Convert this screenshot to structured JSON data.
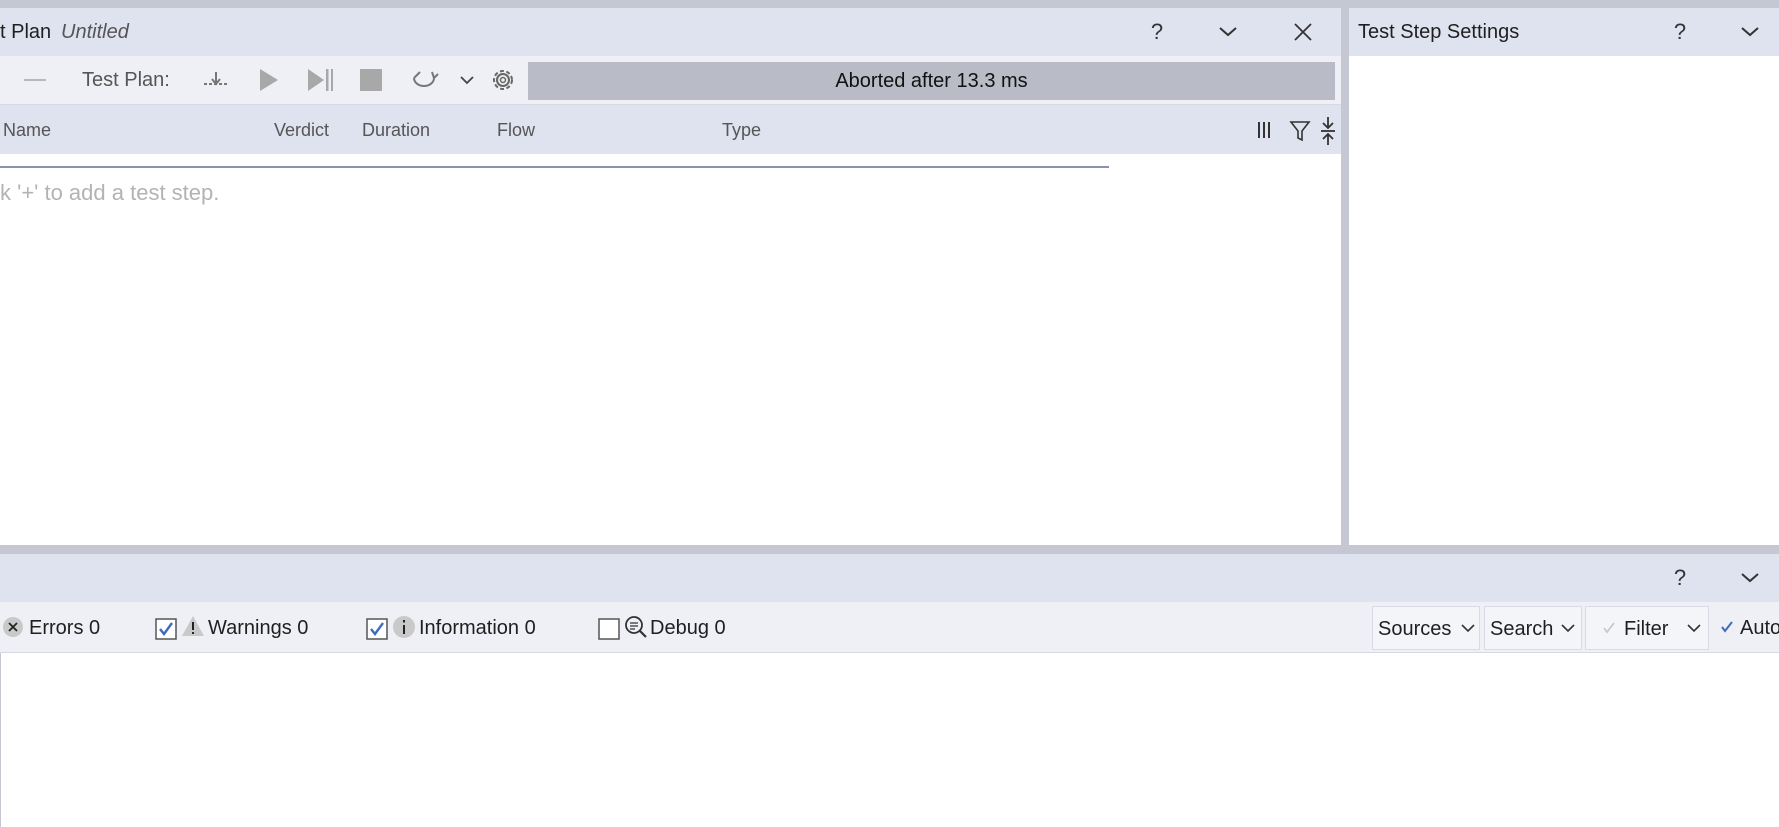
{
  "test_plan_panel": {
    "title": "t Plan",
    "subtitle": "Untitled"
  },
  "toolbar": {
    "test_plan_label": "Test Plan:",
    "status_text": "Aborted after 13.3 ms"
  },
  "grid": {
    "columns": [
      "Name",
      "Verdict",
      "Duration",
      "Flow",
      "Type"
    ],
    "empty_hint": "k '+' to add a test step."
  },
  "settings_panel": {
    "title": "Test Step Settings"
  },
  "log_panel": {
    "errors_label": "Errors 0",
    "warnings_label": "Warnings 0",
    "information_label": "Information 0",
    "debug_label": "Debug 0",
    "warnings_checked": true,
    "information_checked": true,
    "debug_checked": false,
    "sources_label": "Sources",
    "search_label": "Search",
    "filter_label": "Filter",
    "auto_label": "Auto"
  },
  "colors": {
    "header_bg": "#dfe2ef",
    "status_bar_bg": "#b9bcc7",
    "checkbox_accent": "#3e6bbb",
    "splitter": "#c5c8d3"
  },
  "icons": [
    "help-icon",
    "chevron-down-icon",
    "close-icon",
    "insert-step-icon",
    "play-icon",
    "step-forward-icon",
    "stop-icon",
    "repeat-icon",
    "gear-icon",
    "columns-icon",
    "filter-icon",
    "collapse-icon",
    "error-icon",
    "warning-icon",
    "info-icon",
    "debug-icon",
    "check-icon"
  ]
}
